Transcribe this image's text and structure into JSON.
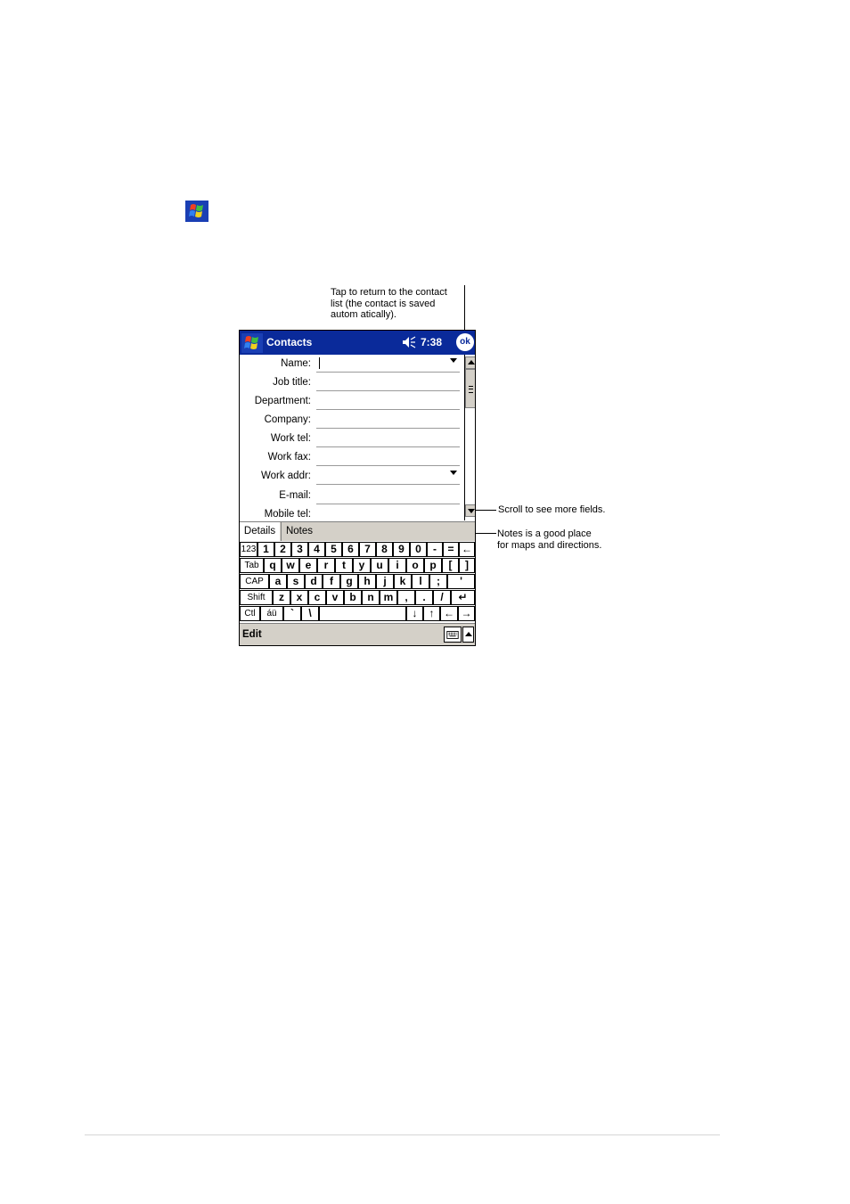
{
  "callouts": {
    "ok_tip": "Tap to return to the contact\nlist (the contact is saved\nautom atically).",
    "scroll_tip": "Scroll to see more fields.",
    "notes_tip": "Notes is a good place\nfor maps and directions."
  },
  "navbar": {
    "title": "Contacts",
    "time": "7:38",
    "ok_label": "ok"
  },
  "fields": [
    {
      "label": "Name:",
      "value": "",
      "dropdown": true
    },
    {
      "label": "Job title:",
      "value": "",
      "dropdown": false
    },
    {
      "label": "Department:",
      "value": "",
      "dropdown": false
    },
    {
      "label": "Company:",
      "value": "",
      "dropdown": false
    },
    {
      "label": "Work tel:",
      "value": "",
      "dropdown": false
    },
    {
      "label": "Work fax:",
      "value": "",
      "dropdown": false
    },
    {
      "label": "Work addr:",
      "value": "",
      "dropdown": true
    },
    {
      "label": "E-mail:",
      "value": "",
      "dropdown": false
    },
    {
      "label": "Mobile tel:",
      "value": "",
      "dropdown": false
    }
  ],
  "tabs": {
    "details": "Details",
    "notes": "Notes"
  },
  "keyboard": {
    "row1": [
      "123",
      "1",
      "2",
      "3",
      "4",
      "5",
      "6",
      "7",
      "8",
      "9",
      "0",
      "-",
      "=",
      "←"
    ],
    "row2": [
      "Tab",
      "q",
      "w",
      "e",
      "r",
      "t",
      "y",
      "u",
      "i",
      "o",
      "p",
      "[",
      "]"
    ],
    "row3": [
      "CAP",
      "a",
      "s",
      "d",
      "f",
      "g",
      "h",
      "j",
      "k",
      "l",
      ";",
      "'"
    ],
    "row4": [
      "Shift",
      "z",
      "x",
      "c",
      "v",
      "b",
      "n",
      "m",
      ",",
      ".",
      "/",
      "↵"
    ],
    "row5": [
      "Ctl",
      "áü",
      "`",
      "\\",
      "",
      "↓",
      "↑",
      "←",
      "→"
    ]
  },
  "menubar": {
    "edit": "Edit"
  }
}
